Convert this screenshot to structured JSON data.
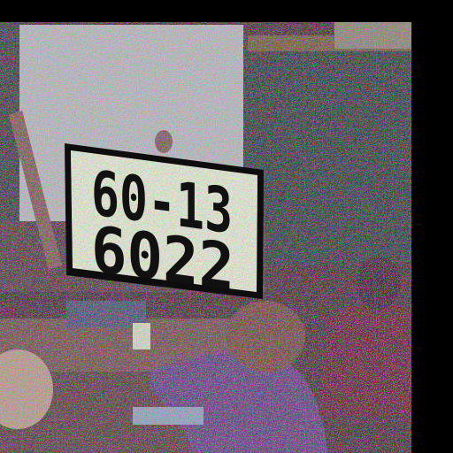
{
  "sign": {
    "line1": "60-13",
    "line2": "6022"
  },
  "colors": {
    "whiteboard": "#b9b6c0",
    "chalkboard": "#1f3a2c",
    "room": "#3a2b22",
    "sign_bg": "#e8e6d8",
    "sign_border": "#0d0d0d",
    "sweater": "#5b3f7a"
  }
}
